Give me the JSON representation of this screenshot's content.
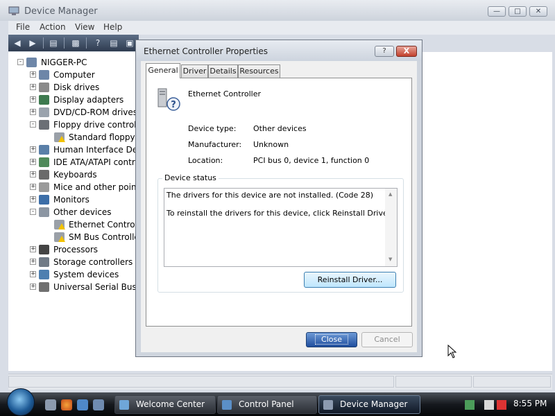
{
  "device_manager": {
    "title": "Device Manager",
    "menu": [
      "File",
      "Action",
      "View",
      "Help"
    ],
    "tree": [
      {
        "label": "NIGGER-PC",
        "level": 0,
        "expander": "-",
        "icon": "computer-icon"
      },
      {
        "label": "Computer",
        "level": 1,
        "expander": "+",
        "icon": "computer-icon"
      },
      {
        "label": "Disk drives",
        "level": 1,
        "expander": "+",
        "icon": "disk-drive-icon"
      },
      {
        "label": "Display adapters",
        "level": 1,
        "expander": "+",
        "icon": "display-adapter-icon"
      },
      {
        "label": "DVD/CD-ROM drives",
        "level": 1,
        "expander": "+",
        "icon": "dvd-drive-icon"
      },
      {
        "label": "Floppy drive controllers",
        "level": 1,
        "expander": "-",
        "icon": "floppy-controller-icon"
      },
      {
        "label": "Standard floppy disk controller",
        "level": 2,
        "expander": "",
        "icon": "warning-device-icon"
      },
      {
        "label": "Human Interface Devices",
        "level": 1,
        "expander": "+",
        "icon": "hid-icon"
      },
      {
        "label": "IDE ATA/ATAPI controllers",
        "level": 1,
        "expander": "+",
        "icon": "ide-controller-icon"
      },
      {
        "label": "Keyboards",
        "level": 1,
        "expander": "+",
        "icon": "keyboard-icon"
      },
      {
        "label": "Mice and other pointing devices",
        "level": 1,
        "expander": "+",
        "icon": "mouse-icon"
      },
      {
        "label": "Monitors",
        "level": 1,
        "expander": "+",
        "icon": "monitor-icon"
      },
      {
        "label": "Other devices",
        "level": 1,
        "expander": "-",
        "icon": "unknown-device-icon"
      },
      {
        "label": "Ethernet Controller",
        "level": 2,
        "expander": "",
        "icon": "warning-device-icon"
      },
      {
        "label": "SM Bus Controller",
        "level": 2,
        "expander": "",
        "icon": "warning-device-icon"
      },
      {
        "label": "Processors",
        "level": 1,
        "expander": "+",
        "icon": "processor-icon"
      },
      {
        "label": "Storage controllers",
        "level": 1,
        "expander": "+",
        "icon": "storage-controller-icon"
      },
      {
        "label": "System devices",
        "level": 1,
        "expander": "+",
        "icon": "system-device-icon"
      },
      {
        "label": "Universal Serial Bus controllers",
        "level": 1,
        "expander": "+",
        "icon": "usb-icon"
      }
    ]
  },
  "properties_dialog": {
    "title": "Ethernet Controller Properties",
    "help_label": "?",
    "close_label": "X",
    "tabs": [
      "General",
      "Driver",
      "Details",
      "Resources"
    ],
    "selected_tab": "General",
    "device_name": "Ethernet Controller",
    "properties": [
      {
        "label": "Device type:",
        "value": "Other devices"
      },
      {
        "label": "Manufacturer:",
        "value": "Unknown"
      },
      {
        "label": "Location:",
        "value": "PCI bus 0, device 1, function 0"
      }
    ],
    "status_group_label": "Device status",
    "status_lines": [
      "The drivers for this device are not installed. (Code 28)",
      "To reinstall the drivers for this device, click Reinstall Driver."
    ],
    "reinstall_button": "Reinstall Driver...",
    "close_button": "Close",
    "cancel_button": "Cancel"
  },
  "taskbar": {
    "tasks": [
      {
        "label": "Welcome Center",
        "icon": "welcome-center-icon",
        "active": false
      },
      {
        "label": "Control Panel",
        "icon": "control-panel-icon",
        "active": false
      },
      {
        "label": "Device Manager",
        "icon": "device-manager-icon",
        "active": true
      }
    ],
    "clock": "8:55 PM"
  },
  "colors": {
    "accent_blue": "#1f4e9e",
    "warning_yellow": "#f2c200",
    "close_red": "#c2412c"
  }
}
